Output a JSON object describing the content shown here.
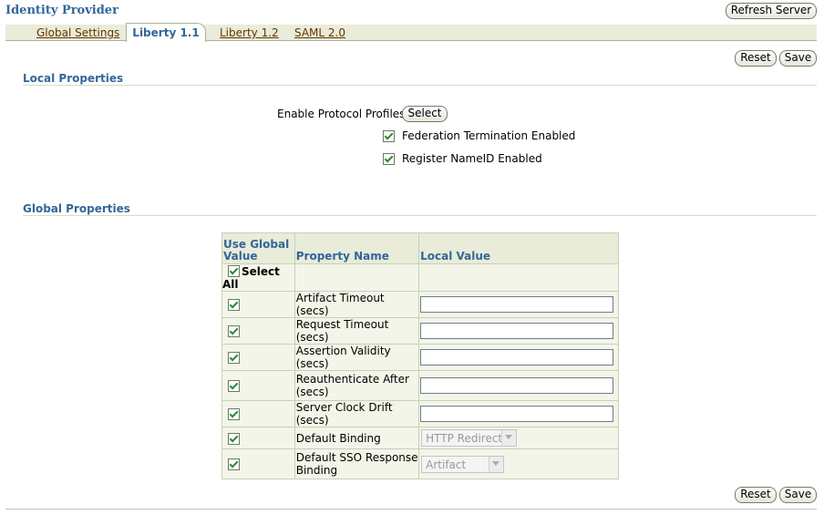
{
  "header": {
    "title": "Identity Provider",
    "refresh_label": "Refresh Server"
  },
  "tabs": [
    {
      "label": "Global Settings",
      "active": false
    },
    {
      "label": "Liberty 1.1",
      "active": true
    },
    {
      "label": "Liberty 1.2",
      "active": false
    },
    {
      "label": "SAML 2.0",
      "active": false
    }
  ],
  "actions": {
    "reset_label": "Reset",
    "save_label": "Save"
  },
  "local_properties": {
    "heading": "Local Properties",
    "enable_protocol_profiles_label": "Enable Protocol Profiles",
    "select_button_label": "Select",
    "federation_termination_label": "Federation Termination Enabled",
    "federation_termination_checked": true,
    "register_nameid_label": "Register NameID Enabled",
    "register_nameid_checked": true
  },
  "global_properties": {
    "heading": "Global Properties",
    "columns": [
      "Use Global Value",
      "Property Name",
      "Local Value"
    ],
    "select_all_label": "Select All",
    "rows": [
      {
        "name": "Artifact Timeout (secs)",
        "use_global": true,
        "value": "",
        "control": "text"
      },
      {
        "name": "Request Timeout (secs)",
        "use_global": true,
        "value": "",
        "control": "text"
      },
      {
        "name": "Assertion Validity (secs)",
        "use_global": true,
        "value": "",
        "control": "text"
      },
      {
        "name": "Reauthenticate After (secs)",
        "use_global": true,
        "value": "",
        "control": "text"
      },
      {
        "name": "Server Clock Drift (secs)",
        "use_global": true,
        "value": "",
        "control": "text"
      },
      {
        "name": "Default Binding",
        "use_global": true,
        "value": "HTTP Redirect",
        "control": "select"
      },
      {
        "name": "Default SSO Response Binding",
        "use_global": true,
        "value": "Artifact",
        "control": "select"
      }
    ]
  },
  "colors": {
    "heading": "#336699",
    "tab_link": "#663300",
    "tab_bar": "#e8ecd8",
    "check": "#2d8a2d"
  }
}
